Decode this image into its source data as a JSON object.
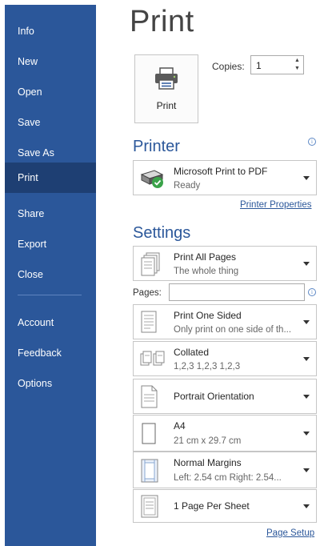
{
  "sidebar": {
    "items": [
      {
        "label": "Info"
      },
      {
        "label": "New"
      },
      {
        "label": "Open"
      },
      {
        "label": "Save"
      },
      {
        "label": "Save As"
      },
      {
        "label": "Print"
      },
      {
        "label": "Share"
      },
      {
        "label": "Export"
      },
      {
        "label": "Close"
      },
      {
        "label": "Account"
      },
      {
        "label": "Feedback"
      },
      {
        "label": "Options"
      }
    ],
    "active_item": "Print",
    "background_color": "#2b579a",
    "active_color": "#1e3f73"
  },
  "main": {
    "title": "Print",
    "print_button_label": "Print",
    "copies_label": "Copies:",
    "copies_value": "1"
  },
  "printer": {
    "section_title": "Printer",
    "name": "Microsoft Print to PDF",
    "status": "Ready",
    "properties_link": "Printer Properties"
  },
  "settings": {
    "section_title": "Settings",
    "pages_label": "Pages:",
    "pages_value": "",
    "options": [
      {
        "main": "Print All Pages",
        "sub": "The whole thing"
      },
      {
        "main": "Print One Sided",
        "sub": "Only print on one side of th..."
      },
      {
        "main": "Collated",
        "sub": "1,2,3    1,2,3    1,2,3"
      },
      {
        "main": "Portrait Orientation",
        "sub": ""
      },
      {
        "main": "A4",
        "sub": "21 cm x 29.7 cm"
      },
      {
        "main": "Normal Margins",
        "sub": "Left:  2.54 cm    Right:  2.54..."
      },
      {
        "main": "1 Page Per Sheet",
        "sub": ""
      }
    ],
    "page_setup_link": "Page Setup"
  },
  "colors": {
    "accent": "#2b579a",
    "text": "#262626",
    "muted": "#666666",
    "border": "#c6c6c6"
  }
}
